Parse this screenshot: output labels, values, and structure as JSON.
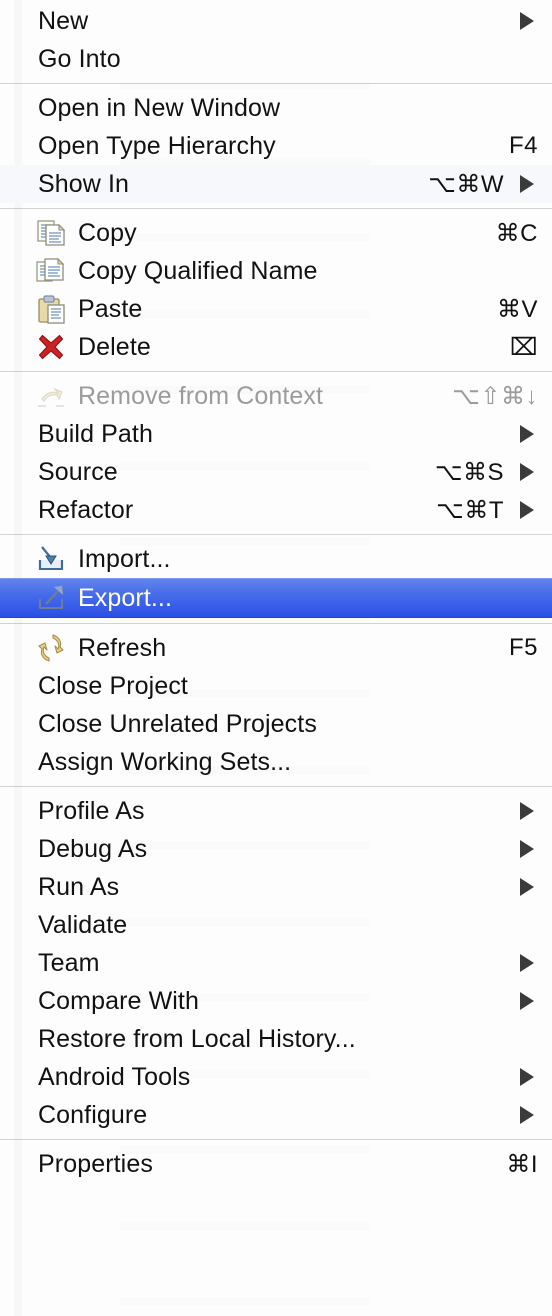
{
  "menu": {
    "type": "context-menu",
    "app_context": "Eclipse IDE project explorer context menu",
    "selected_item": "Export...",
    "colors": {
      "highlight_top": "#6184ec",
      "highlight_bottom": "#2b4fe6",
      "highlight_text": "#ffffff",
      "background": "#fdfdfd",
      "text": "#121212",
      "disabled_text": "#9b9b9b",
      "separator": "#d2d2d2"
    },
    "sections": [
      {
        "id": "section-new",
        "items": [
          {
            "label": "New",
            "shortcut": "",
            "submenu": true,
            "icon": "",
            "state": "enabled"
          },
          {
            "label": "Go Into",
            "shortcut": "",
            "submenu": false,
            "icon": "",
            "state": "enabled"
          }
        ]
      },
      {
        "id": "section-open",
        "items": [
          {
            "label": "Open in New Window",
            "shortcut": "",
            "submenu": false,
            "icon": "",
            "state": "enabled"
          },
          {
            "label": "Open Type Hierarchy",
            "shortcut": "F4",
            "submenu": false,
            "icon": "",
            "state": "enabled"
          },
          {
            "label": "Show In",
            "shortcut": "⌥⌘W",
            "submenu": true,
            "icon": "",
            "state": "enabled",
            "highlight": "tinted"
          }
        ]
      },
      {
        "id": "section-clipboard",
        "items": [
          {
            "label": "Copy",
            "shortcut": "⌘C",
            "submenu": false,
            "icon": "copy-icon",
            "state": "enabled"
          },
          {
            "label": "Copy Qualified Name",
            "shortcut": "",
            "submenu": false,
            "icon": "copy-qualified-name-icon",
            "state": "enabled"
          },
          {
            "label": "Paste",
            "shortcut": "⌘V",
            "submenu": false,
            "icon": "paste-icon",
            "state": "enabled"
          },
          {
            "label": "Delete",
            "shortcut": "⌧",
            "submenu": false,
            "icon": "delete-icon",
            "state": "enabled"
          }
        ]
      },
      {
        "id": "section-build",
        "items": [
          {
            "label": "Remove from Context",
            "shortcut": "⌥⇧⌘↓",
            "submenu": false,
            "icon": "remove-from-context-icon",
            "state": "disabled"
          },
          {
            "label": "Build Path",
            "shortcut": "",
            "submenu": true,
            "icon": "",
            "state": "enabled"
          },
          {
            "label": "Source",
            "shortcut": "⌥⌘S",
            "submenu": true,
            "icon": "",
            "state": "enabled"
          },
          {
            "label": "Refactor",
            "shortcut": "⌥⌘T",
            "submenu": true,
            "icon": "",
            "state": "enabled"
          }
        ]
      },
      {
        "id": "section-transfer",
        "items": [
          {
            "label": "Import...",
            "shortcut": "",
            "submenu": false,
            "icon": "import-icon",
            "state": "enabled"
          },
          {
            "label": "Export...",
            "shortcut": "",
            "submenu": false,
            "icon": "export-icon",
            "state": "enabled",
            "highlight": "selected"
          }
        ]
      },
      {
        "id": "section-project",
        "items": [
          {
            "label": "Refresh",
            "shortcut": "F5",
            "submenu": false,
            "icon": "refresh-icon",
            "state": "enabled"
          },
          {
            "label": "Close Project",
            "shortcut": "",
            "submenu": false,
            "icon": "",
            "state": "enabled"
          },
          {
            "label": "Close Unrelated Projects",
            "shortcut": "",
            "submenu": false,
            "icon": "",
            "state": "enabled"
          },
          {
            "label": "Assign Working Sets...",
            "shortcut": "",
            "submenu": false,
            "icon": "",
            "state": "enabled"
          }
        ]
      },
      {
        "id": "section-run",
        "items": [
          {
            "label": "Profile As",
            "shortcut": "",
            "submenu": true,
            "icon": "",
            "state": "enabled"
          },
          {
            "label": "Debug As",
            "shortcut": "",
            "submenu": true,
            "icon": "",
            "state": "enabled"
          },
          {
            "label": "Run As",
            "shortcut": "",
            "submenu": true,
            "icon": "",
            "state": "enabled"
          },
          {
            "label": "Validate",
            "shortcut": "",
            "submenu": false,
            "icon": "",
            "state": "enabled"
          },
          {
            "label": "Team",
            "shortcut": "",
            "submenu": true,
            "icon": "",
            "state": "enabled"
          },
          {
            "label": "Compare With",
            "shortcut": "",
            "submenu": true,
            "icon": "",
            "state": "enabled"
          },
          {
            "label": "Restore from Local History...",
            "shortcut": "",
            "submenu": false,
            "icon": "",
            "state": "enabled"
          },
          {
            "label": "Android Tools",
            "shortcut": "",
            "submenu": true,
            "icon": "",
            "state": "enabled"
          },
          {
            "label": "Configure",
            "shortcut": "",
            "submenu": true,
            "icon": "",
            "state": "enabled"
          }
        ]
      },
      {
        "id": "section-properties",
        "items": [
          {
            "label": "Properties",
            "shortcut": "⌘I",
            "submenu": false,
            "icon": "",
            "state": "enabled"
          }
        ]
      }
    ]
  }
}
